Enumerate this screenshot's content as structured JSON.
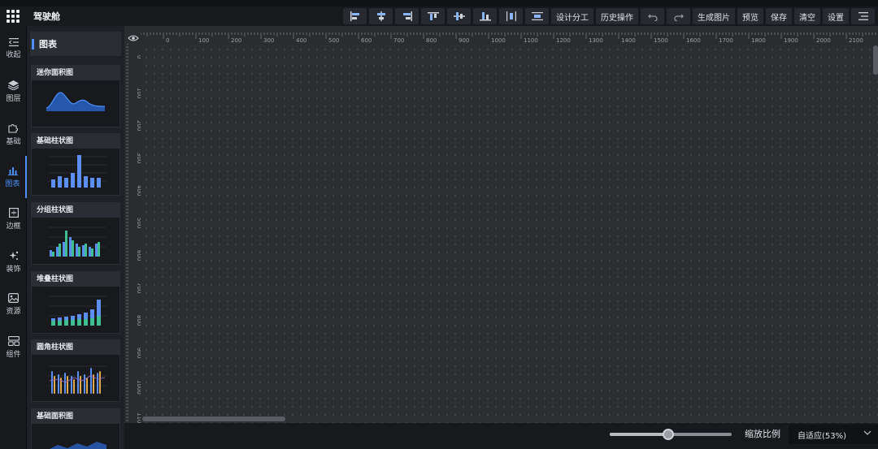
{
  "app": {
    "title": "驾驶舱"
  },
  "toolbar": {
    "align_icons": [
      "align-left-icon",
      "align-center-h-icon",
      "align-right-icon",
      "align-top-icon",
      "align-middle-v-icon",
      "align-bottom-icon",
      "distribute-horizontal-icon",
      "distribute-vertical-icon"
    ],
    "design_split": "设计分工",
    "history": "历史操作",
    "undo_icon": "undo-icon",
    "redo_icon": "redo-icon",
    "generate_image": "生成图片",
    "preview": "预览",
    "save": "保存",
    "clear": "清空",
    "settings": "设置",
    "more_icon": "menu-icon"
  },
  "rail": {
    "items": [
      {
        "label": "收起",
        "icon": "collapse-icon"
      },
      {
        "label": "图层",
        "icon": "layers-icon"
      },
      {
        "label": "基础",
        "icon": "puzzle-icon"
      },
      {
        "label": "图表",
        "icon": "bar-chart-icon",
        "active": true
      },
      {
        "label": "边框",
        "icon": "border-icon"
      },
      {
        "label": "装饰",
        "icon": "sparkle-icon"
      },
      {
        "label": "资源",
        "icon": "image-icon"
      },
      {
        "label": "组件",
        "icon": "component-icon"
      }
    ]
  },
  "panel": {
    "title": "图表",
    "cards": [
      {
        "title": "迷你面积图"
      },
      {
        "title": "基础柱状图"
      },
      {
        "title": "分组柱状图"
      },
      {
        "title": "堆叠柱状图"
      },
      {
        "title": "圆角柱状图"
      },
      {
        "title": "基础面积图"
      }
    ]
  },
  "ruler": {
    "h_labels": [
      "0",
      "100",
      "200",
      "300",
      "400",
      "500",
      "600",
      "700",
      "800",
      "900",
      "1000",
      "1100",
      "1200",
      "1300",
      "1400",
      "1500",
      "1600",
      "1700",
      "1800",
      "1900",
      "2000",
      "2100"
    ],
    "v_labels": [
      "0",
      "100",
      "200",
      "300",
      "400",
      "500",
      "600",
      "700",
      "800",
      "900",
      "1000",
      "1100"
    ]
  },
  "zoom": {
    "label": "缩放比例",
    "value": "自适应(53%)",
    "slider_level": 0.48
  }
}
